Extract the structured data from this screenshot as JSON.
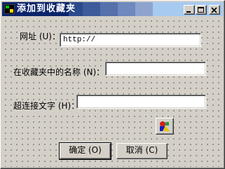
{
  "window": {
    "title": "添加到收藏夹",
    "buttons": [
      "minimize",
      "maximize",
      "close"
    ]
  },
  "form": {
    "url_label": "网址 (U)：",
    "url_value": "http://",
    "name_label": "在收藏夹中的名称 (N)：",
    "name_value": "",
    "text_label": "超连接文字 (H)：",
    "text_value": "",
    "shapes_icon": "shapes-icon"
  },
  "actions": {
    "ok_label": "确定 (O)",
    "cancel_label": "取消 (C)"
  },
  "colors": {
    "face": "#d4d0c8",
    "titlebar_active": "#0a246a",
    "titlebar_light": "#a6caf0"
  }
}
